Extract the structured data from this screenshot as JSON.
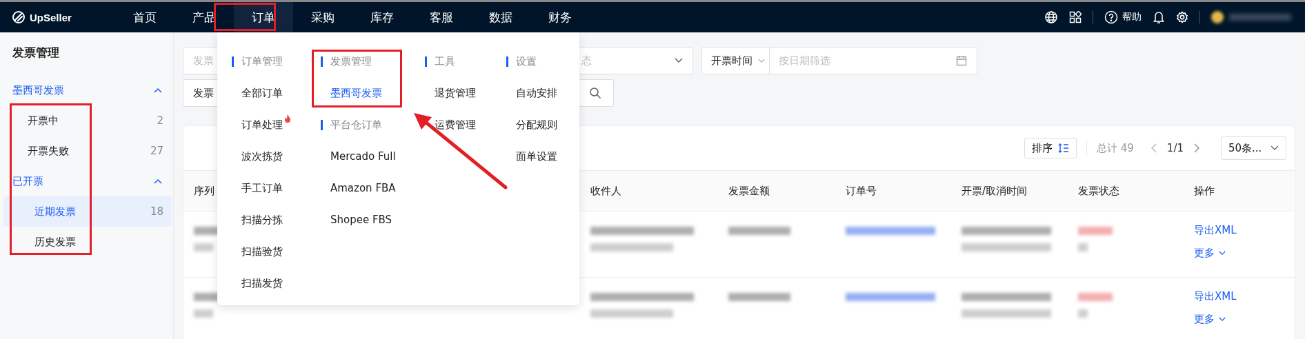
{
  "topbar": {
    "logo": "UpSeller",
    "nav": [
      {
        "label": "首页",
        "selected": false
      },
      {
        "label": "产品",
        "selected": false
      },
      {
        "label": "订单",
        "selected": true
      },
      {
        "label": "采购",
        "selected": false
      },
      {
        "label": "库存",
        "selected": false
      },
      {
        "label": "客服",
        "selected": false
      },
      {
        "label": "数据",
        "selected": false
      },
      {
        "label": "财务",
        "selected": false
      }
    ],
    "help": "帮助"
  },
  "sidebar": {
    "title": "发票管理",
    "groups": [
      {
        "label": "墨西哥发票",
        "expanded": true,
        "items": [
          {
            "label": "开票中",
            "count": "2",
            "selected": false
          },
          {
            "label": "开票失败",
            "count": "27",
            "selected": false
          }
        ]
      },
      {
        "label": "已开票",
        "expanded": true,
        "items": [
          {
            "label": "近期发票",
            "count": "18",
            "selected": true
          },
          {
            "label": "历史发票",
            "selected": false
          }
        ]
      }
    ]
  },
  "filters": {
    "invoice_field": {
      "placeholder": "发票"
    },
    "status_select": {
      "placeholder": "态"
    },
    "date_filter": {
      "type": "开票时间",
      "placeholder": "按日期筛选"
    },
    "search_type": {
      "value": "发票"
    }
  },
  "table": {
    "sort": "排序",
    "total": "总计 49",
    "page": "1/1",
    "page_size": "50条...",
    "columns": [
      "序列",
      "收件人",
      "发票金额",
      "订单号",
      "开票/取消时间",
      "发票状态",
      "操作"
    ],
    "rows": [
      {
        "actions": [
          "导出XML",
          "更多"
        ]
      },
      {
        "actions": [
          "导出XML",
          "更多"
        ]
      }
    ]
  },
  "menu": {
    "columns": [
      {
        "sections": [
          {
            "title": "订单管理",
            "items": [
              {
                "label": "全部订单",
                "selected": false,
                "hot": false
              },
              {
                "label": "订单处理",
                "selected": false,
                "hot": true
              },
              {
                "label": "波次拣货",
                "selected": false,
                "hot": false
              },
              {
                "label": "手工订单",
                "selected": false,
                "hot": false
              },
              {
                "label": "扫描分拣",
                "selected": false,
                "hot": false
              },
              {
                "label": "扫描验货",
                "selected": false,
                "hot": false
              },
              {
                "label": "扫描发货",
                "selected": false,
                "hot": false
              }
            ]
          }
        ]
      },
      {
        "sections": [
          {
            "title": "发票管理",
            "items": [
              {
                "label": "墨西哥发票",
                "selected": true,
                "hot": false
              }
            ]
          },
          {
            "title": "平台仓订单",
            "items": [
              {
                "label": "Mercado Full",
                "selected": false,
                "hot": false
              },
              {
                "label": "Amazon FBA",
                "selected": false,
                "hot": false
              },
              {
                "label": "Shopee FBS",
                "selected": false,
                "hot": false
              }
            ]
          }
        ]
      },
      {
        "sections": [
          {
            "title": "工具",
            "items": [
              {
                "label": "退货管理",
                "selected": false,
                "hot": false
              },
              {
                "label": "运费管理",
                "selected": false,
                "hot": false
              }
            ]
          }
        ]
      },
      {
        "sections": [
          {
            "title": "设置",
            "items": [
              {
                "label": "自动安排",
                "selected": false,
                "hot": false
              },
              {
                "label": "分配规则",
                "selected": false,
                "hot": false
              },
              {
                "label": "面单设置",
                "selected": false,
                "hot": false
              }
            ]
          }
        ]
      }
    ]
  }
}
